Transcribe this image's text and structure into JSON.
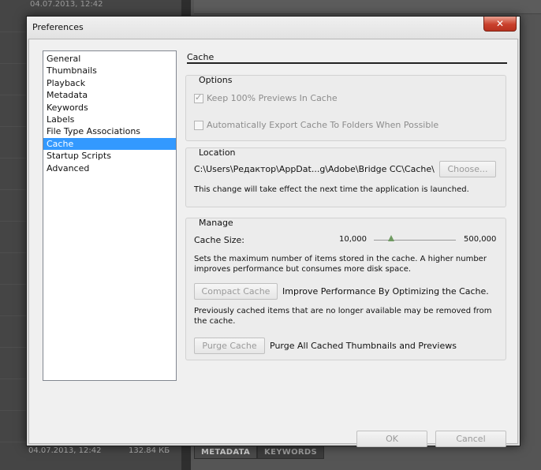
{
  "background": {
    "top_text": "04.07.2013, 12:42",
    "bottom_date": "04.07.2013, 12:42",
    "bottom_size": "132.84 КБ",
    "tabs": [
      "METADATA",
      "KEYWORDS"
    ]
  },
  "dialog": {
    "title": "Preferences",
    "close_glyph": "✕",
    "categories": [
      "General",
      "Thumbnails",
      "Playback",
      "Metadata",
      "Keywords",
      "Labels",
      "File Type Associations",
      "Cache",
      "Startup Scripts",
      "Advanced"
    ],
    "selected_category": "Cache",
    "panel_title": "Cache",
    "options": {
      "title": "Options",
      "keep_previews": {
        "label": "Keep 100% Previews In Cache",
        "checked": true,
        "enabled": false
      },
      "auto_export": {
        "label": "Automatically Export Cache To Folders When Possible",
        "checked": false,
        "enabled": false
      }
    },
    "location": {
      "title": "Location",
      "path": "C:\\Users\\Редактор\\AppDat...g\\Adobe\\Bridge CC\\Cache\\",
      "choose_button": "Choose...",
      "note": "This change will take effect the next time the application is launched."
    },
    "manage": {
      "title": "Manage",
      "cache_size_label": "Cache Size:",
      "slider_min": "10,000",
      "slider_max": "500,000",
      "slider_fraction": 0.21,
      "slider_note": "Sets the maximum number of items stored in the cache. A higher number improves performance but consumes more disk space.",
      "compact_button": "Compact Cache",
      "compact_desc": "Improve Performance By Optimizing the Cache.",
      "compact_note": "Previously cached items that are no longer available may be removed from the cache.",
      "purge_button": "Purge Cache",
      "purge_desc": "Purge All Cached Thumbnails and Previews"
    },
    "ok_button": "OK",
    "cancel_button": "Cancel"
  },
  "colors": {
    "selection": "#3399ff",
    "close_button": "#c9402c",
    "slider_thumb": "#6f9a61"
  }
}
